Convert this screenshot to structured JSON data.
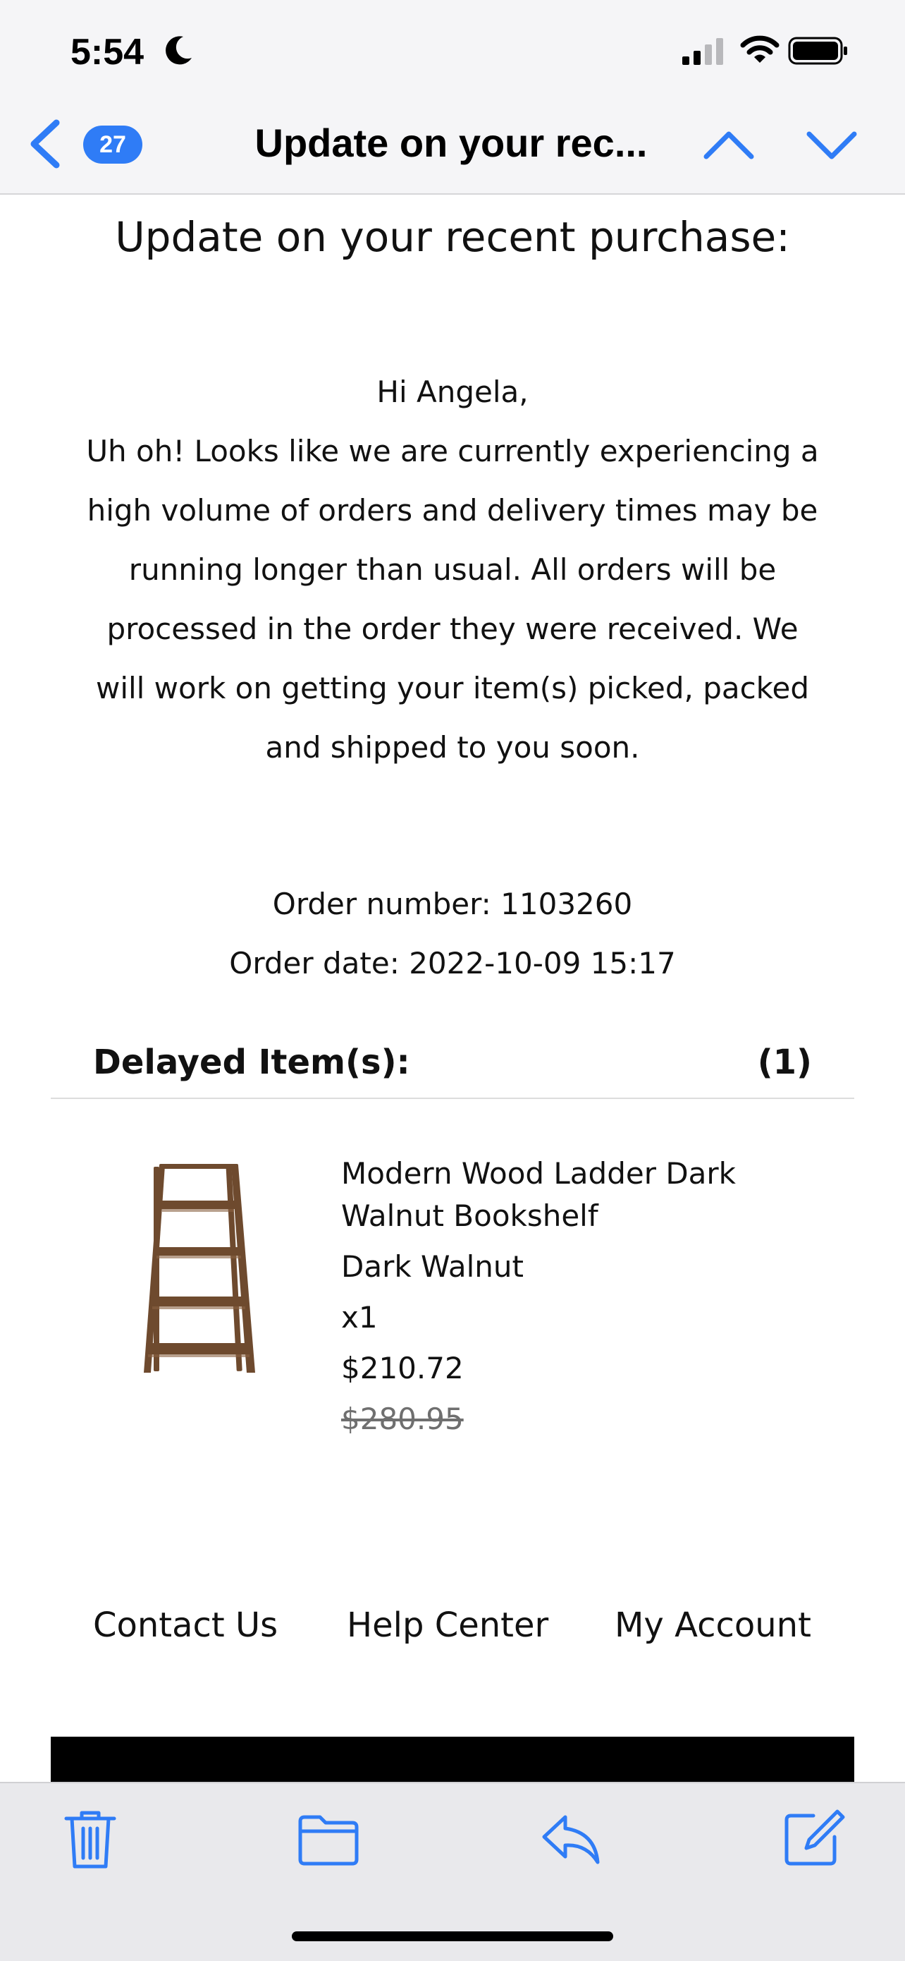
{
  "status_bar": {
    "time": "5:54",
    "icons": [
      "moon-icon",
      "cellular-signal-icon",
      "wifi-icon",
      "battery-icon"
    ]
  },
  "nav": {
    "back_icon": "chevron-left-icon",
    "unread_count": "27",
    "title": "Update on your rec...",
    "up_icon": "chevron-up-icon",
    "down_icon": "chevron-down-icon"
  },
  "email": {
    "heading": "Update on your recent purchase:",
    "greeting": "Hi Angela,",
    "message": "Uh oh! Looks like we are currently experiencing a high volume of orders and delivery times may be running longer than usual. All orders will be processed in the order they were received. We will work on getting your item(s) picked, packed and shipped to you soon.",
    "order_number": "Order number: 1103260",
    "order_date": "Order date: 2022-10-09 15:17",
    "delayed_label": "Delayed Item(s):",
    "delayed_count": "(1)",
    "item": {
      "name": "Modern Wood Ladder Dark Walnut Bookshelf",
      "color": "Dark Walnut",
      "quantity": "x1",
      "price": "$210.72",
      "original_price": "$280.95"
    },
    "footer_links": [
      "Contact Us",
      "Help Center",
      "My Account"
    ]
  },
  "toolbar": {
    "icons": [
      "trash-icon",
      "folder-icon",
      "reply-icon",
      "compose-icon"
    ]
  },
  "colors": {
    "accent": "#2f7cf6",
    "chrome_background": "#f5f5f7",
    "text": "#111111"
  }
}
